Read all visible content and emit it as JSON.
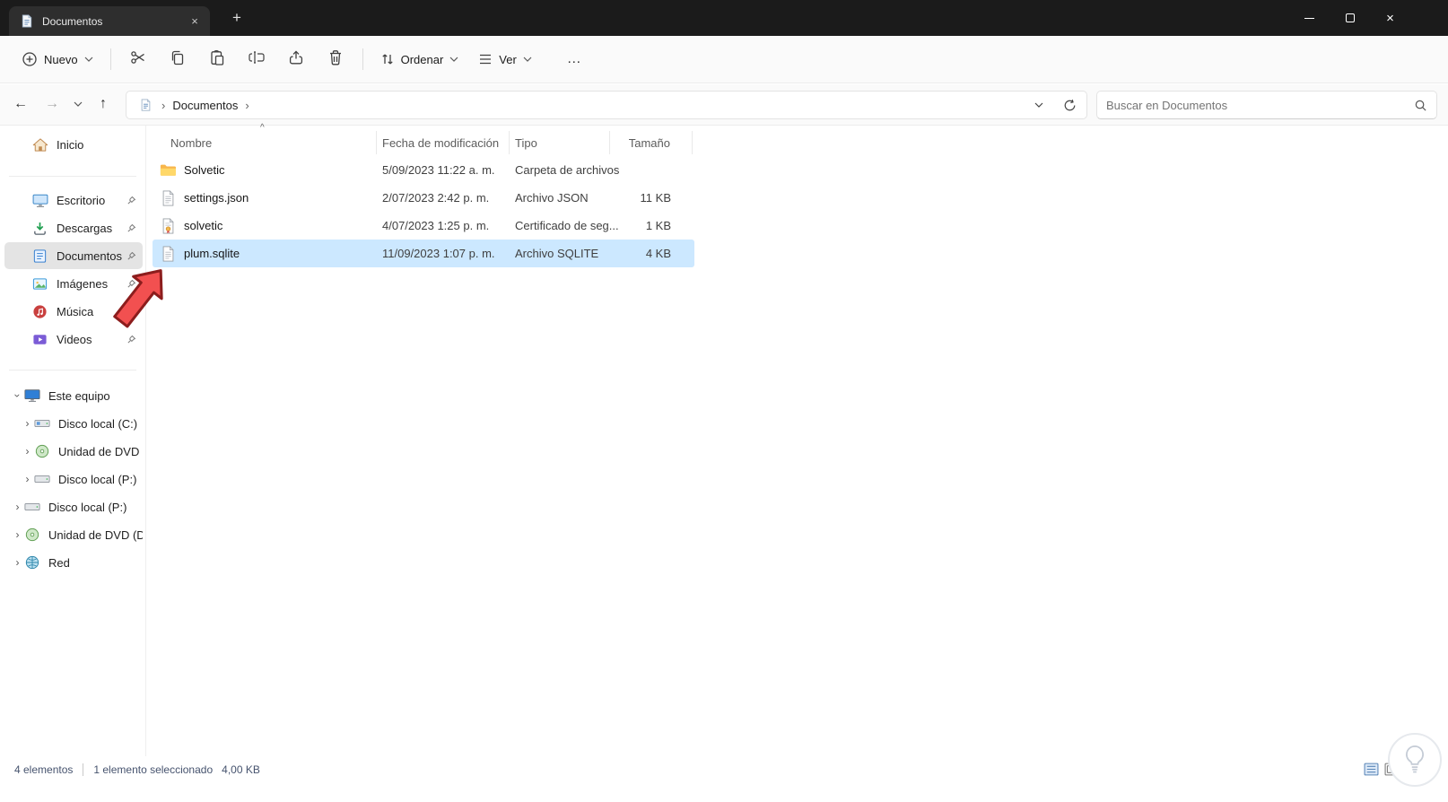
{
  "icons": {
    "close": "×",
    "new_tab": "+",
    "more": "…",
    "back": "←",
    "forward": "→",
    "up": "↑",
    "chevron": "›",
    "sort_caret": "^"
  },
  "titlebar": {
    "tab_title": "Documentos"
  },
  "toolbar": {
    "new_label": "Nuevo",
    "sort_label": "Ordenar",
    "view_label": "Ver"
  },
  "navigation": {
    "breadcrumb_root": "Documentos",
    "search_placeholder": "Buscar en Documentos"
  },
  "sidebar": {
    "quick": [
      {
        "label": "Inicio",
        "pinned": false
      },
      {
        "label": "Escritorio",
        "pinned": true
      },
      {
        "label": "Descargas",
        "pinned": true
      },
      {
        "label": "Documentos",
        "pinned": true,
        "selected": true
      },
      {
        "label": "Imágenes",
        "pinned": true
      },
      {
        "label": "Música",
        "pinned": true
      },
      {
        "label": "Videos",
        "pinned": true
      }
    ],
    "tree": [
      {
        "label": "Este equipo",
        "expanded": true
      },
      {
        "label": "Disco local (C:)"
      },
      {
        "label": "Unidad de DVD (D"
      },
      {
        "label": "Disco local (P:)"
      },
      {
        "label": "Disco local (P:)"
      },
      {
        "label": "Unidad de DVD (D:)"
      },
      {
        "label": "Red"
      }
    ]
  },
  "files": {
    "columns": {
      "name": "Nombre",
      "date": "Fecha de modificación",
      "type": "Tipo",
      "size": "Tamaño"
    },
    "rows": [
      {
        "name": "Solvetic",
        "date": "5/09/2023 11:22 a. m.",
        "type": "Carpeta de archivos",
        "size": ""
      },
      {
        "name": "settings.json",
        "date": "2/07/2023 2:42 p. m.",
        "type": "Archivo JSON",
        "size": "11 KB"
      },
      {
        "name": "solvetic",
        "date": "4/07/2023 1:25 p. m.",
        "type": "Certificado de seg...",
        "size": "1 KB"
      },
      {
        "name": "plum.sqlite",
        "date": "11/09/2023 1:07 p. m.",
        "type": "Archivo SQLITE",
        "size": "4 KB",
        "selected": true
      }
    ]
  },
  "statusbar": {
    "items_count": "4 elementos",
    "selection": "1 elemento seleccionado",
    "selection_size": "4,00 KB"
  },
  "colors": {
    "selection_blue": "#cce8ff",
    "titlebar_bg": "#1b1b1b",
    "folder_yellow": "#ffc94a",
    "arrow_red": "#f25050"
  }
}
